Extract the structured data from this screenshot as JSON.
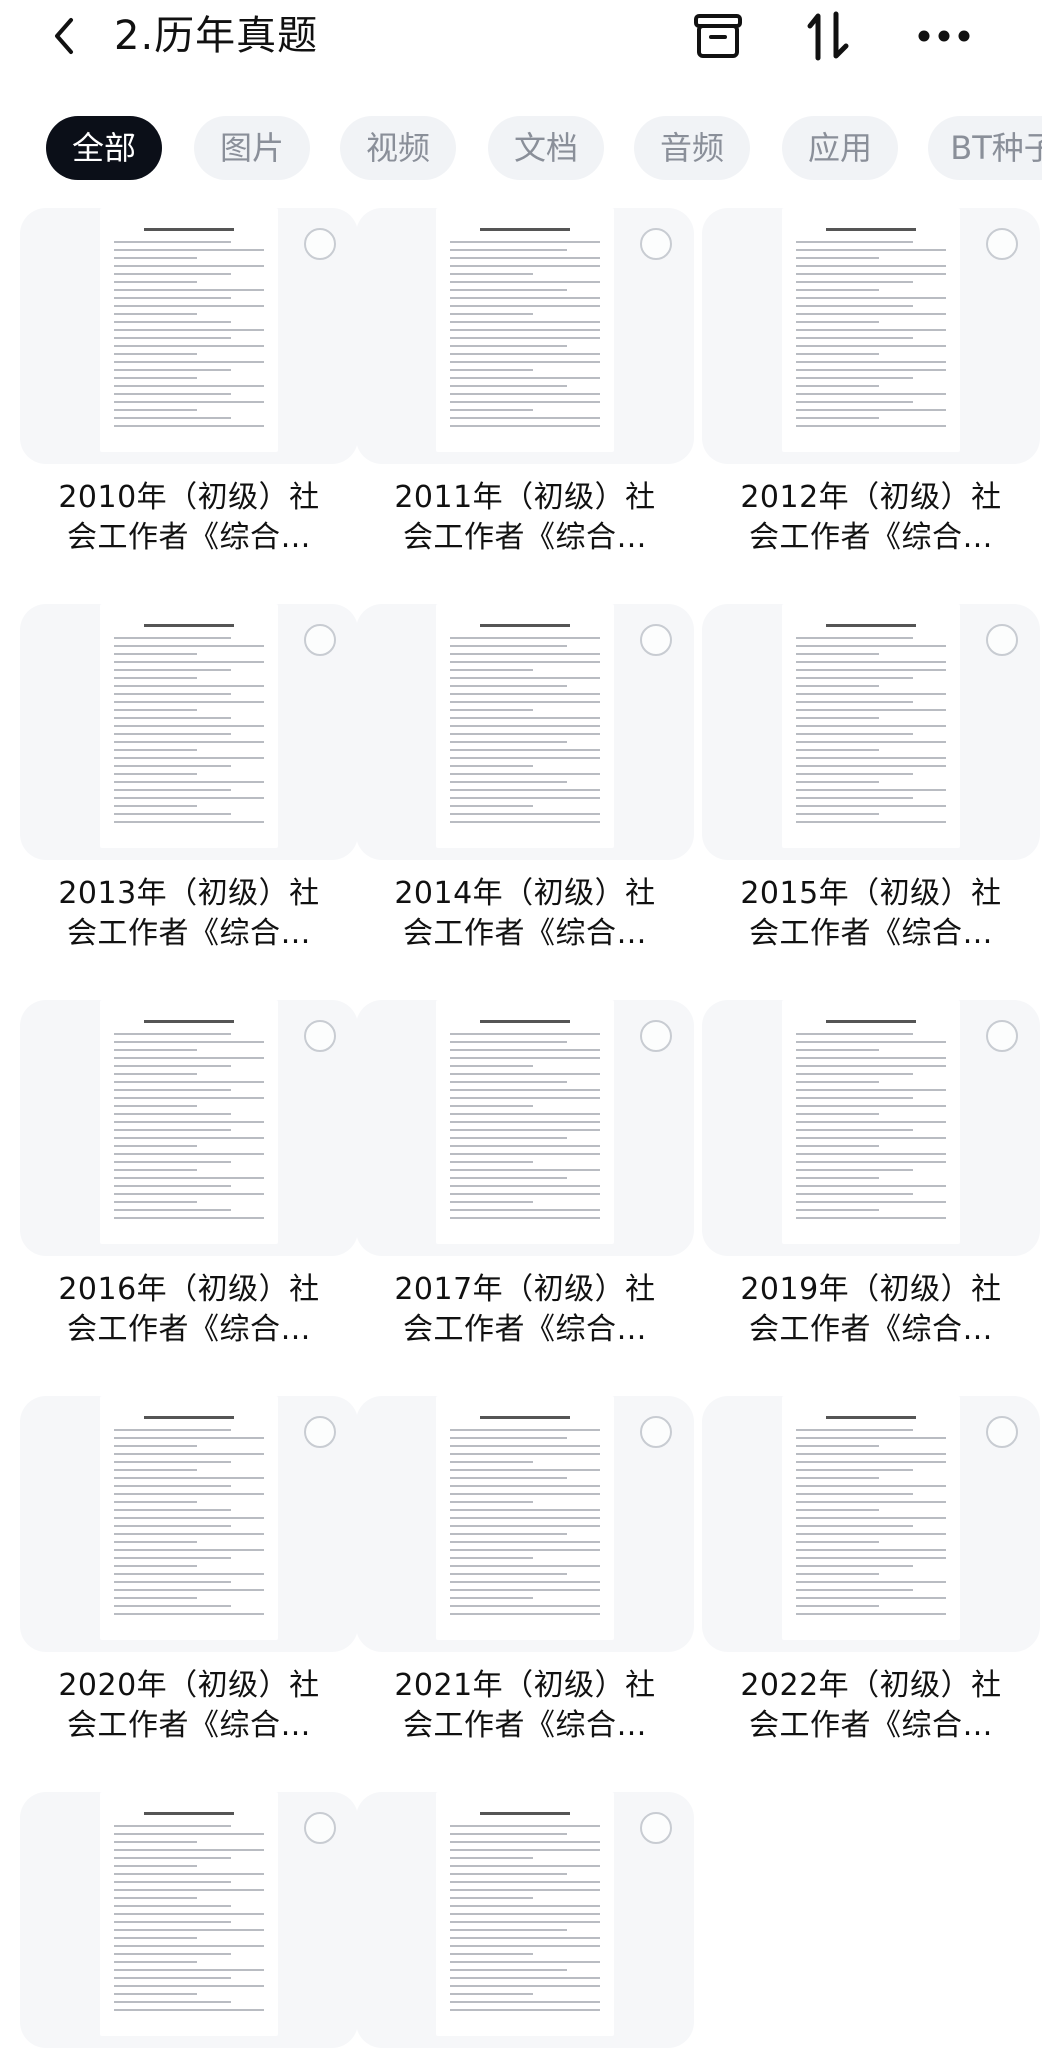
{
  "header": {
    "title": "2.历年真题",
    "back_icon": "chevron-left-icon",
    "archive_icon": "archive-box-icon",
    "sort_icon": "sort-arrows-icon",
    "more_icon": "more-horizontal-icon"
  },
  "tabs": [
    {
      "label": "全部",
      "active": true
    },
    {
      "label": "图片",
      "active": false
    },
    {
      "label": "视频",
      "active": false
    },
    {
      "label": "文档",
      "active": false
    },
    {
      "label": "音频",
      "active": false
    },
    {
      "label": "应用",
      "active": false
    },
    {
      "label": "BT种子",
      "active": false
    }
  ],
  "files": [
    {
      "line1": "2010年（初级）社",
      "line2": "会工作者《综合…"
    },
    {
      "line1": "2011年（初级）社",
      "line2": "会工作者《综合…"
    },
    {
      "line1": "2012年（初级）社",
      "line2": "会工作者《综合…"
    },
    {
      "line1": "2013年（初级）社",
      "line2": "会工作者《综合…"
    },
    {
      "line1": "2014年（初级）社",
      "line2": "会工作者《综合…"
    },
    {
      "line1": "2015年（初级）社",
      "line2": "会工作者《综合…"
    },
    {
      "line1": "2016年（初级）社",
      "line2": "会工作者《综合…"
    },
    {
      "line1": "2017年（初级）社",
      "line2": "会工作者《综合…"
    },
    {
      "line1": "2019年（初级）社",
      "line2": "会工作者《综合…"
    },
    {
      "line1": "2020年（初级）社",
      "line2": "会工作者《综合…"
    },
    {
      "line1": "2021年（初级）社",
      "line2": "会工作者《综合…"
    },
    {
      "line1": "2022年（初级）社",
      "line2": "会工作者《综合…"
    },
    {
      "line1": "",
      "line2": ""
    },
    {
      "line1": "",
      "line2": ""
    }
  ]
}
